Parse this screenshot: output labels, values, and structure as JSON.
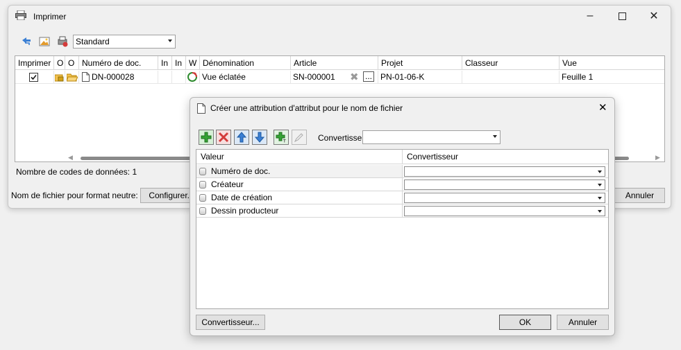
{
  "main_window": {
    "title": "Imprimer",
    "toolbar": {
      "profile_value": "Standard"
    },
    "columns": [
      "Imprimer",
      "O",
      "O",
      "Numéro de doc.",
      "In",
      "In",
      "W",
      "Dénomination",
      "Article",
      "Projet",
      "Classeur",
      "Vue"
    ],
    "row": {
      "printed": true,
      "doc_number": "DN-000028",
      "denomination": "Vue éclatée",
      "article": "SN-000001",
      "more": "...",
      "project": "PN-01-06-K",
      "classeur": "",
      "view": "Feuille 1"
    },
    "status": "Nombre de codes de données: 1",
    "neutral_label": "Nom de fichier pour format neutre:",
    "configure_button": "Configurer...",
    "cancel_button": "Annuler"
  },
  "dialog": {
    "title": "Créer une attribution d'attribut pour le nom de fichier",
    "convert_label": "Convertisse",
    "convert_value": "",
    "columns": [
      "Valeur",
      "Convertisseur"
    ],
    "rows": [
      {
        "value": "Numéro de doc.",
        "converter": ""
      },
      {
        "value": "Créateur",
        "converter": ""
      },
      {
        "value": "Date de création",
        "converter": ""
      },
      {
        "value": "Dessin producteur",
        "converter": ""
      }
    ],
    "converter_button": "Convertisseur...",
    "ok_button": "OK",
    "cancel_button": "Annuler"
  },
  "colors": {
    "accent_green": "#35a335",
    "accent_red": "#d43a3a",
    "accent_blue": "#3a7fd4"
  }
}
